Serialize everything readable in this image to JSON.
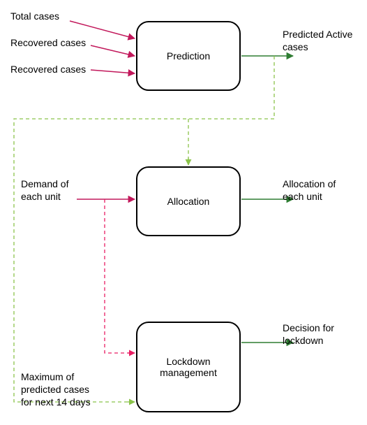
{
  "boxes": {
    "prediction": {
      "label": "Prediction"
    },
    "allocation": {
      "label": "Allocation"
    },
    "lockdown": {
      "label": "Lockdown\nmanagement"
    }
  },
  "inputs": {
    "total_cases": "Total cases",
    "recovered_cases1": "Recovered cases",
    "recovered_cases2": "Recovered cases",
    "demand": "Demand of\neach unit",
    "max_predicted": "Maximum of\npredicted cases\nfor next 14 days"
  },
  "outputs": {
    "predicted_active": "Predicted Active\ncases",
    "allocation_out": "Allocation  of\neach unit",
    "decision": "Decision for\nlockdown"
  },
  "colors": {
    "input_arrow": "#c2185b",
    "output_arrow": "#2e7d32",
    "dashed_green": "#8bc34a",
    "dashed_pink": "#e91e63",
    "box_border": "#000000"
  }
}
